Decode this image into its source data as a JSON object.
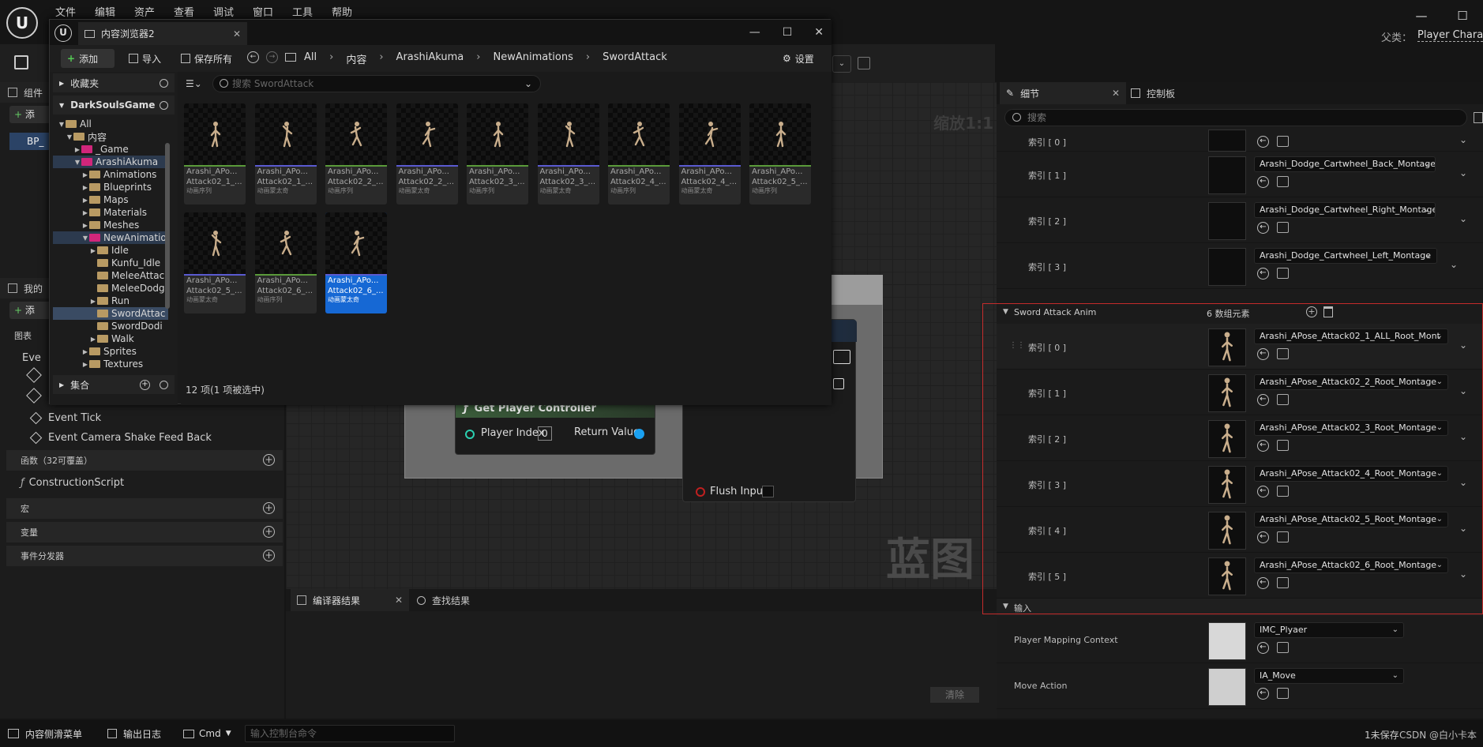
{
  "menu": [
    "文件",
    "编辑",
    "资产",
    "查看",
    "调试",
    "窗口",
    "工具",
    "帮助"
  ],
  "parent": {
    "label": "父类：",
    "value": "Player Chara"
  },
  "left_panel": {
    "components_tab": "组件",
    "add_label": "添",
    "bp_item": "BP_",
    "my_blueprint_tab": "我的",
    "add2_label": "添",
    "graph_section": "图表",
    "event_graph": "Eve",
    "events": [
      "Event Tick",
      "Event Camera Shake Feed Back"
    ],
    "functions_section": "函数（32可覆盖）",
    "construction_script": "ConstructionScript",
    "macros_section": "宏",
    "variables_section": "变量",
    "dispatchers_section": "事件分发器"
  },
  "graph": {
    "zoom": "缩放1:1",
    "watermark": "蓝图",
    "node_gpc": {
      "title": "Get Player Controller",
      "pin_in": "Player Index",
      "pin_in_value": "0",
      "pin_out": "Return Value"
    },
    "node_right": {
      "flush_input": "Flush Input"
    }
  },
  "bottom_dock": {
    "tab1": "编译器结果",
    "tab2": "查找结果",
    "clear": "清除"
  },
  "statusbar": {
    "drawer": "内容侧滑菜单",
    "output_log": "输出日志",
    "cmd": "Cmd",
    "console_placeholder": "输入控制台命令",
    "right": "1未保存",
    "watermark": "CSDN @白小卡本"
  },
  "details": {
    "tab_details": "细节",
    "tab_palette": "控制板",
    "search_placeholder": "搜索",
    "top_rows": [
      {
        "index": "索引 [ 0 ]",
        "asset": ""
      },
      {
        "index": "索引 [ 1 ]",
        "asset": "Arashi_Dodge_Cartwheel_Back_Montage"
      },
      {
        "index": "索引 [ 2 ]",
        "asset": "Arashi_Dodge_Cartwheel_Right_Montage"
      },
      {
        "index": "索引 [ 3 ]",
        "asset": "Arashi_Dodge_Cartwheel_Left_Montage"
      }
    ],
    "sword_attack": {
      "label": "Sword Attack Anim",
      "count": "6 数组元素"
    },
    "sword_rows": [
      {
        "index": "索引 [ 0 ]",
        "asset": "Arashi_APose_Attack02_1_ALL_Root_Mont"
      },
      {
        "index": "索引 [ 1 ]",
        "asset": "Arashi_APose_Attack02_2_Root_Montage"
      },
      {
        "index": "索引 [ 2 ]",
        "asset": "Arashi_APose_Attack02_3_Root_Montage"
      },
      {
        "index": "索引 [ 3 ]",
        "asset": "Arashi_APose_Attack02_4_Root_Montage"
      },
      {
        "index": "索引 [ 4 ]",
        "asset": "Arashi_APose_Attack02_5_Root_Montage"
      },
      {
        "index": "索引 [ 5 ]",
        "asset": "Arashi_APose_Attack02_6_Root_Montage"
      }
    ],
    "input_section": "输入",
    "input_rows": [
      {
        "name": "Player Mapping Context",
        "asset": "IMC_Plyaer"
      },
      {
        "name": "Move Action",
        "asset": "IA_Move"
      }
    ]
  },
  "content_browser": {
    "title": "内容浏览器2",
    "add": "添加",
    "import": "导入",
    "save_all": "保存所有",
    "breadcrumb": [
      "All",
      "内容",
      "ArashiAkuma",
      "NewAnimations",
      "SwordAttack"
    ],
    "settings": "设置",
    "favorites": "收藏夹",
    "project": "DarkSoulsGame",
    "collections": "集合",
    "search_placeholder": "搜索 SwordAttack",
    "status": "12 项(1 项被选中)",
    "tree": [
      {
        "label": "All",
        "depth": 0,
        "open": true,
        "color": "tan"
      },
      {
        "label": "内容",
        "depth": 1,
        "open": true,
        "color": "tan"
      },
      {
        "label": "_Game",
        "depth": 2,
        "open": false,
        "color": "pink"
      },
      {
        "label": "ArashiAkuma",
        "depth": 2,
        "open": true,
        "color": "pink",
        "sel": true
      },
      {
        "label": "Animations",
        "depth": 3,
        "open": false,
        "color": "tan"
      },
      {
        "label": "Blueprints",
        "depth": 3,
        "open": false,
        "color": "tan"
      },
      {
        "label": "Maps",
        "depth": 3,
        "open": false,
        "color": "tan"
      },
      {
        "label": "Materials",
        "depth": 3,
        "open": false,
        "color": "tan"
      },
      {
        "label": "Meshes",
        "depth": 3,
        "open": false,
        "color": "tan"
      },
      {
        "label": "NewAnimatio",
        "depth": 3,
        "open": true,
        "color": "pink",
        "sel": true
      },
      {
        "label": "Idle",
        "depth": 4,
        "open": false,
        "color": "tan"
      },
      {
        "label": "Kunfu_Idle",
        "depth": 4,
        "open": null,
        "color": "tan"
      },
      {
        "label": "MeleeAttac",
        "depth": 4,
        "open": null,
        "color": "tan"
      },
      {
        "label": "MeleeDodg",
        "depth": 4,
        "open": null,
        "color": "tan"
      },
      {
        "label": "Run",
        "depth": 4,
        "open": false,
        "color": "tan"
      },
      {
        "label": "SwordAttac",
        "depth": 4,
        "open": null,
        "color": "tan",
        "current": true
      },
      {
        "label": "SwordDodi",
        "depth": 4,
        "open": null,
        "color": "tan"
      },
      {
        "label": "Walk",
        "depth": 4,
        "open": false,
        "color": "tan"
      },
      {
        "label": "Sprites",
        "depth": 3,
        "open": false,
        "color": "tan"
      },
      {
        "label": "Textures",
        "depth": 3,
        "open": false,
        "color": "tan"
      }
    ],
    "assets": [
      {
        "n1": "Arashi_APo...",
        "n2": "Attack02_1_...",
        "type": "动画序列",
        "kind": "seq"
      },
      {
        "n1": "Arashi_APo...",
        "n2": "Attack02_1_...",
        "type": "动画蒙太奇",
        "kind": "mon"
      },
      {
        "n1": "Arashi_APo...",
        "n2": "Attack02_2_...",
        "type": "动画序列",
        "kind": "seq"
      },
      {
        "n1": "Arashi_APo...",
        "n2": "Attack02_2_...",
        "type": "动画蒙太奇",
        "kind": "mon"
      },
      {
        "n1": "Arashi_APo...",
        "n2": "Attack02_3_...",
        "type": "动画序列",
        "kind": "seq"
      },
      {
        "n1": "Arashi_APo...",
        "n2": "Attack02_3_...",
        "type": "动画蒙太奇",
        "kind": "mon"
      },
      {
        "n1": "Arashi_APo...",
        "n2": "Attack02_4_...",
        "type": "动画序列",
        "kind": "seq"
      },
      {
        "n1": "Arashi_APo...",
        "n2": "Attack02_4_...",
        "type": "动画蒙太奇",
        "kind": "mon"
      },
      {
        "n1": "Arashi_APo...",
        "n2": "Attack02_5_...",
        "type": "动画序列",
        "kind": "seq"
      },
      {
        "n1": "Arashi_APo...",
        "n2": "Attack02_5_...",
        "type": "动画蒙太奇",
        "kind": "mon"
      },
      {
        "n1": "Arashi_APo...",
        "n2": "Attack02_6_...",
        "type": "动画序列",
        "kind": "seq"
      },
      {
        "n1": "Arashi_APo...",
        "n2": "Attack02_6_...",
        "type": "动画蒙太奇",
        "kind": "mon",
        "selected": true
      }
    ]
  },
  "colors": {
    "seq": "#5a9a3a",
    "mon": "#5a5ad0",
    "selection": "#1668d4",
    "highlight_box": "#c42b2b"
  }
}
